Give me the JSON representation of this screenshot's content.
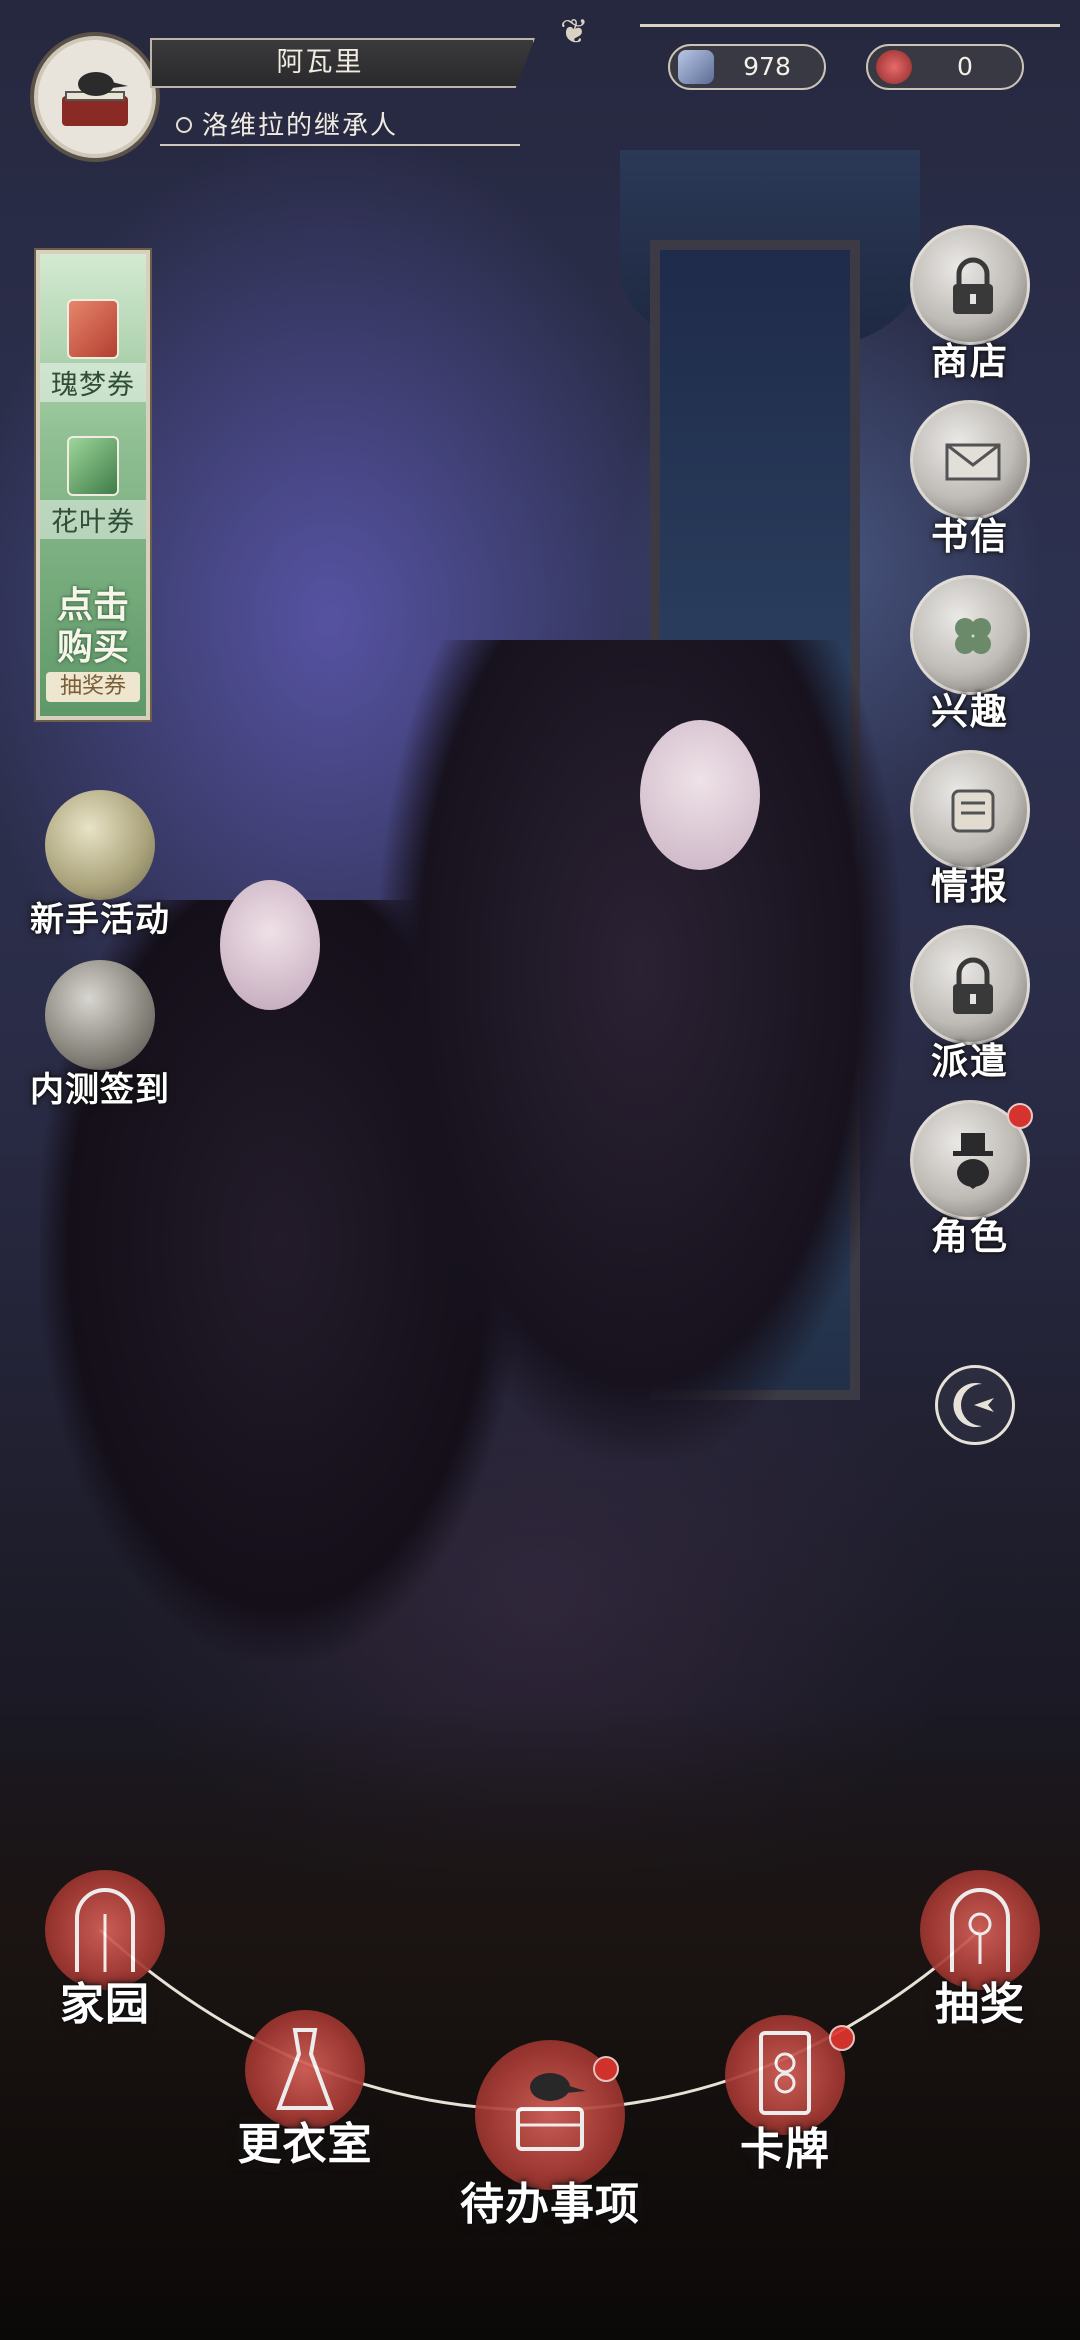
{
  "player": {
    "name": "阿瓦里",
    "title": "洛维拉的继承人"
  },
  "currencies": [
    {
      "icon": "gem-card-icon",
      "value": "978"
    },
    {
      "icon": "rose-icon",
      "value": "0"
    }
  ],
  "ticket_panel": {
    "tickets": [
      {
        "label": "瑰梦券",
        "icon": "rose-ticket-icon"
      },
      {
        "label": "花叶券",
        "icon": "leaf-ticket-icon"
      }
    ],
    "buy_label_line1": "点击",
    "buy_label_line2": "购买",
    "buy_sub": "抽奖券"
  },
  "left_events": [
    {
      "label": "新手活动",
      "icon": "moon-orb-icon"
    },
    {
      "label": "内测签到",
      "icon": "crow-letter-icon"
    }
  ],
  "right_menu": [
    {
      "label": "商店",
      "icon": "lock-icon",
      "locked": true,
      "badge": false
    },
    {
      "label": "书信",
      "icon": "envelope-icon",
      "locked": false,
      "badge": false
    },
    {
      "label": "兴趣",
      "icon": "clover-icon",
      "locked": false,
      "badge": false
    },
    {
      "label": "情报",
      "icon": "scroll-icon",
      "locked": false,
      "badge": false
    },
    {
      "label": "派遣",
      "icon": "lock-icon",
      "locked": true,
      "badge": false
    },
    {
      "label": "角色",
      "icon": "crow-tophat-icon",
      "locked": false,
      "badge": true
    }
  ],
  "moon_button_icon": "crescent-icon",
  "bottom_nav": [
    {
      "label": "家园",
      "icon": "gate-icon",
      "badge": false
    },
    {
      "label": "更衣室",
      "icon": "dress-icon",
      "badge": false
    },
    {
      "label": "待办事项",
      "icon": "crow-desk-icon",
      "badge": true
    },
    {
      "label": "卡牌",
      "icon": "tarot-card-icon",
      "badge": true
    },
    {
      "label": "抽奖",
      "icon": "rose-arch-icon",
      "badge": false
    }
  ],
  "colors": {
    "badge_red": "#e0342e",
    "nav_red": "#a63a34",
    "ticket_green": "#8fbf92"
  }
}
